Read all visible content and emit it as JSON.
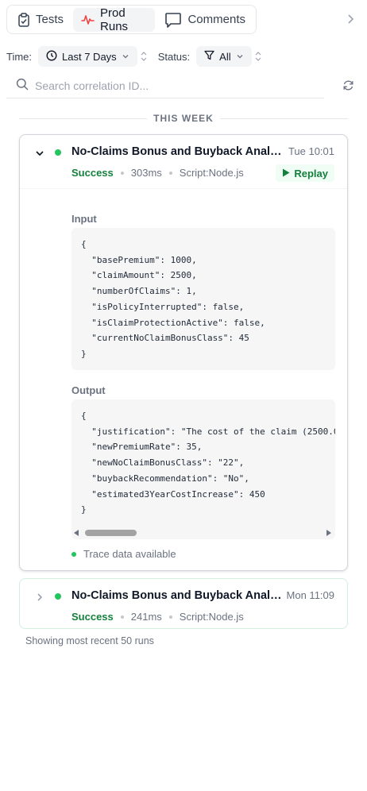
{
  "tabs": [
    {
      "label": "Tests",
      "icon": "clipboard-icon"
    },
    {
      "label": "Prod Runs",
      "icon": "activity-icon"
    },
    {
      "label": "Comments",
      "icon": "comment-icon"
    }
  ],
  "filters": {
    "time_label": "Time:",
    "time_value": "Last 7 Days",
    "status_label": "Status:",
    "status_value": "All"
  },
  "search": {
    "placeholder": "Search correlation ID..."
  },
  "section_header": "THIS WEEK",
  "runs": [
    {
      "title": "No-Claims Bonus and Buyback Analysis",
      "time": "Tue 10:01",
      "status": "Success",
      "duration": "303ms",
      "source": "Script:Node.js",
      "replay_label": "Replay",
      "input_label": "Input",
      "input_json": "{\n  \"basePremium\": 1000,\n  \"claimAmount\": 2500,\n  \"numberOfClaims\": 1,\n  \"isPolicyInterrupted\": false,\n  \"isClaimProtectionActive\": false,\n  \"currentNoClaimBonusClass\": 45\n}",
      "output_label": "Output",
      "output_json": "{\n  \"justification\": \"The cost of the claim (2500.0\n  \"newPremiumRate\": 35,\n  \"newNoClaimBonusClass\": \"22\",\n  \"buybackRecommendation\": \"No\",\n  \"estimated3YearCostIncrease\": 450\n}",
      "trace_text": "Trace data available"
    },
    {
      "title": "No-Claims Bonus and Buyback Analysis",
      "time": "Mon 11:09",
      "status": "Success",
      "duration": "241ms",
      "source": "Script:Node.js"
    }
  ],
  "footer": "Showing most recent 50 runs",
  "colors": {
    "success": "#15803d",
    "status_dot": "#22c55e",
    "accent_red": "#ef4444"
  }
}
